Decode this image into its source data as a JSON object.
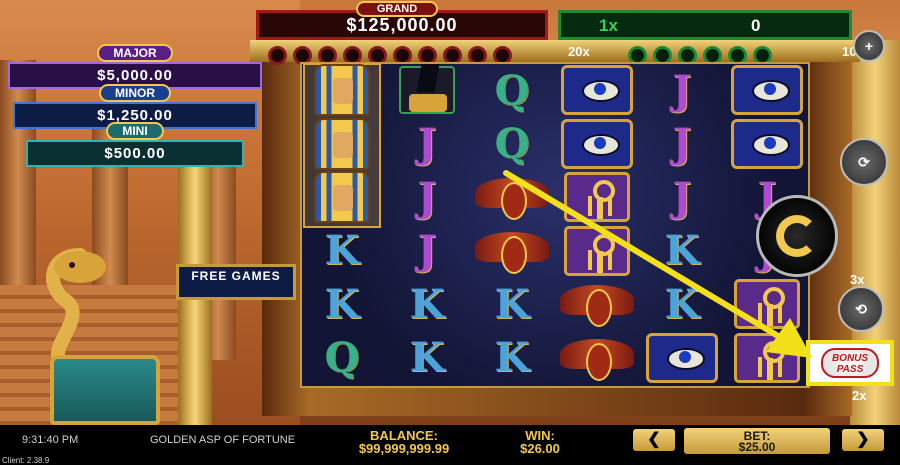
{
  "jackpots": {
    "grand_label": "GRAND",
    "grand_value": "$125,000.00",
    "major_label": "MAJOR",
    "major_value": "$5,000.00",
    "minor_label": "MINOR",
    "minor_value": "$1,250.00",
    "mini_label": "MINI",
    "mini_value": "$500.00"
  },
  "multiplier_panel": {
    "multiplier": "1x",
    "win": "0"
  },
  "reel_badges": {
    "top_mult": "20x",
    "top_right": "10",
    "mid_right": "3x",
    "bottom_right": "2x"
  },
  "free_games_label": "FREE GAMES",
  "bonus_pass_label": "BONUS PASS",
  "reels": [
    [
      "pharaoh",
      "anubis",
      "Q",
      "eye",
      "J",
      "eye"
    ],
    [
      "pharaoh",
      "J",
      "Q",
      "eye",
      "J",
      "eye"
    ],
    [
      "pharaoh",
      "J",
      "scarab",
      "ankh",
      "J",
      "J"
    ],
    [
      "K",
      "J",
      "scarab",
      "ankh",
      "K",
      "J"
    ],
    [
      "K",
      "K",
      "K",
      "scarab",
      "K",
      "ankh"
    ],
    [
      "Q",
      "K",
      "K",
      "scarab",
      "eye",
      "ankh"
    ]
  ],
  "bottom_bar": {
    "time": "9:31:40 PM",
    "game_title": "GOLDEN ASP OF FORTUNE",
    "balance_label": "BALANCE:",
    "balance_value": "$99,999,999.99",
    "win_label": "WIN:",
    "win_value": "$26.00",
    "bet_label": "BET:",
    "bet_value": "$25.00",
    "prev_symbol": "❮",
    "next_symbol": "❯",
    "client_version": "Client: 2.38.9"
  },
  "colors": {
    "accent_gold": "#f2c94c",
    "highlight_yellow": "#f2e01a",
    "grand_red": "#a31818",
    "multiplier_green": "#35d15a"
  }
}
